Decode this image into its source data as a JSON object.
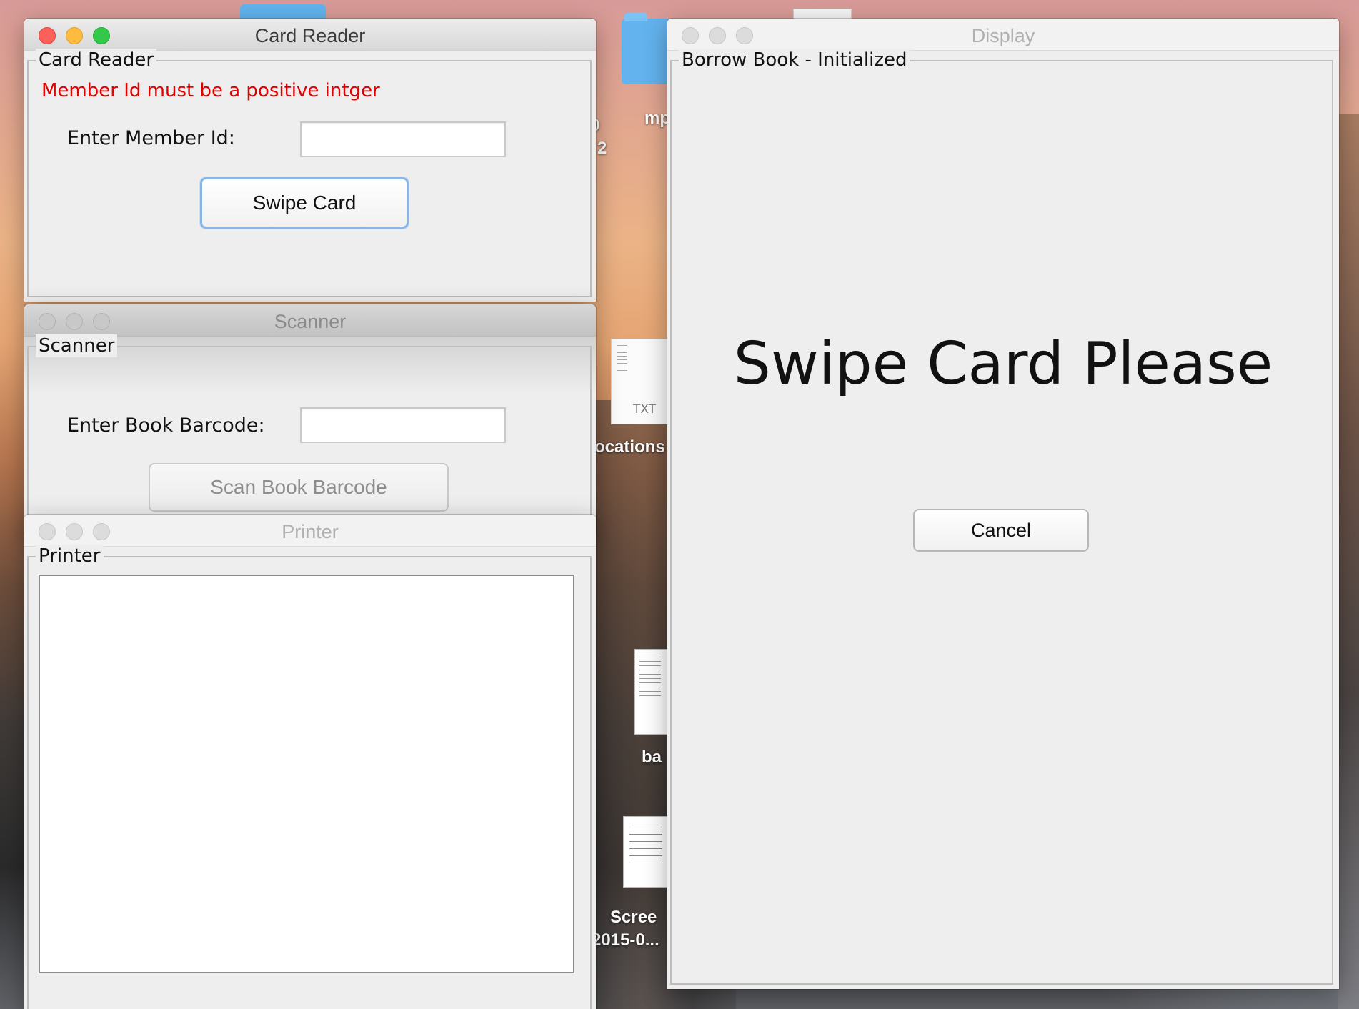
{
  "desktop": {
    "icons": [
      {
        "label": "mp"
      },
      {
        "label": "0"
      },
      {
        "label": "2"
      },
      {
        "label": "ocations"
      },
      {
        "label": "TXT"
      },
      {
        "label": "ba"
      },
      {
        "label": "Scree"
      },
      {
        "label": "2015-0..."
      }
    ]
  },
  "card_reader": {
    "window_title": "Card Reader",
    "group_title": "Card Reader",
    "error_message": "Member Id must be a positive intger",
    "member_id_label": "Enter Member Id:",
    "member_id_value": "",
    "swipe_button": "Swipe Card"
  },
  "scanner": {
    "window_title": "Scanner",
    "group_title": "Scanner",
    "barcode_label": "Enter Book Barcode:",
    "barcode_value": "",
    "scan_button": "Scan Book Barcode"
  },
  "printer": {
    "window_title": "Printer",
    "group_title": "Printer",
    "output_text": ""
  },
  "display": {
    "window_title": "Display",
    "group_title": "Borrow Book - Initialized",
    "message": "Swipe Card Please",
    "cancel_button": "Cancel"
  }
}
